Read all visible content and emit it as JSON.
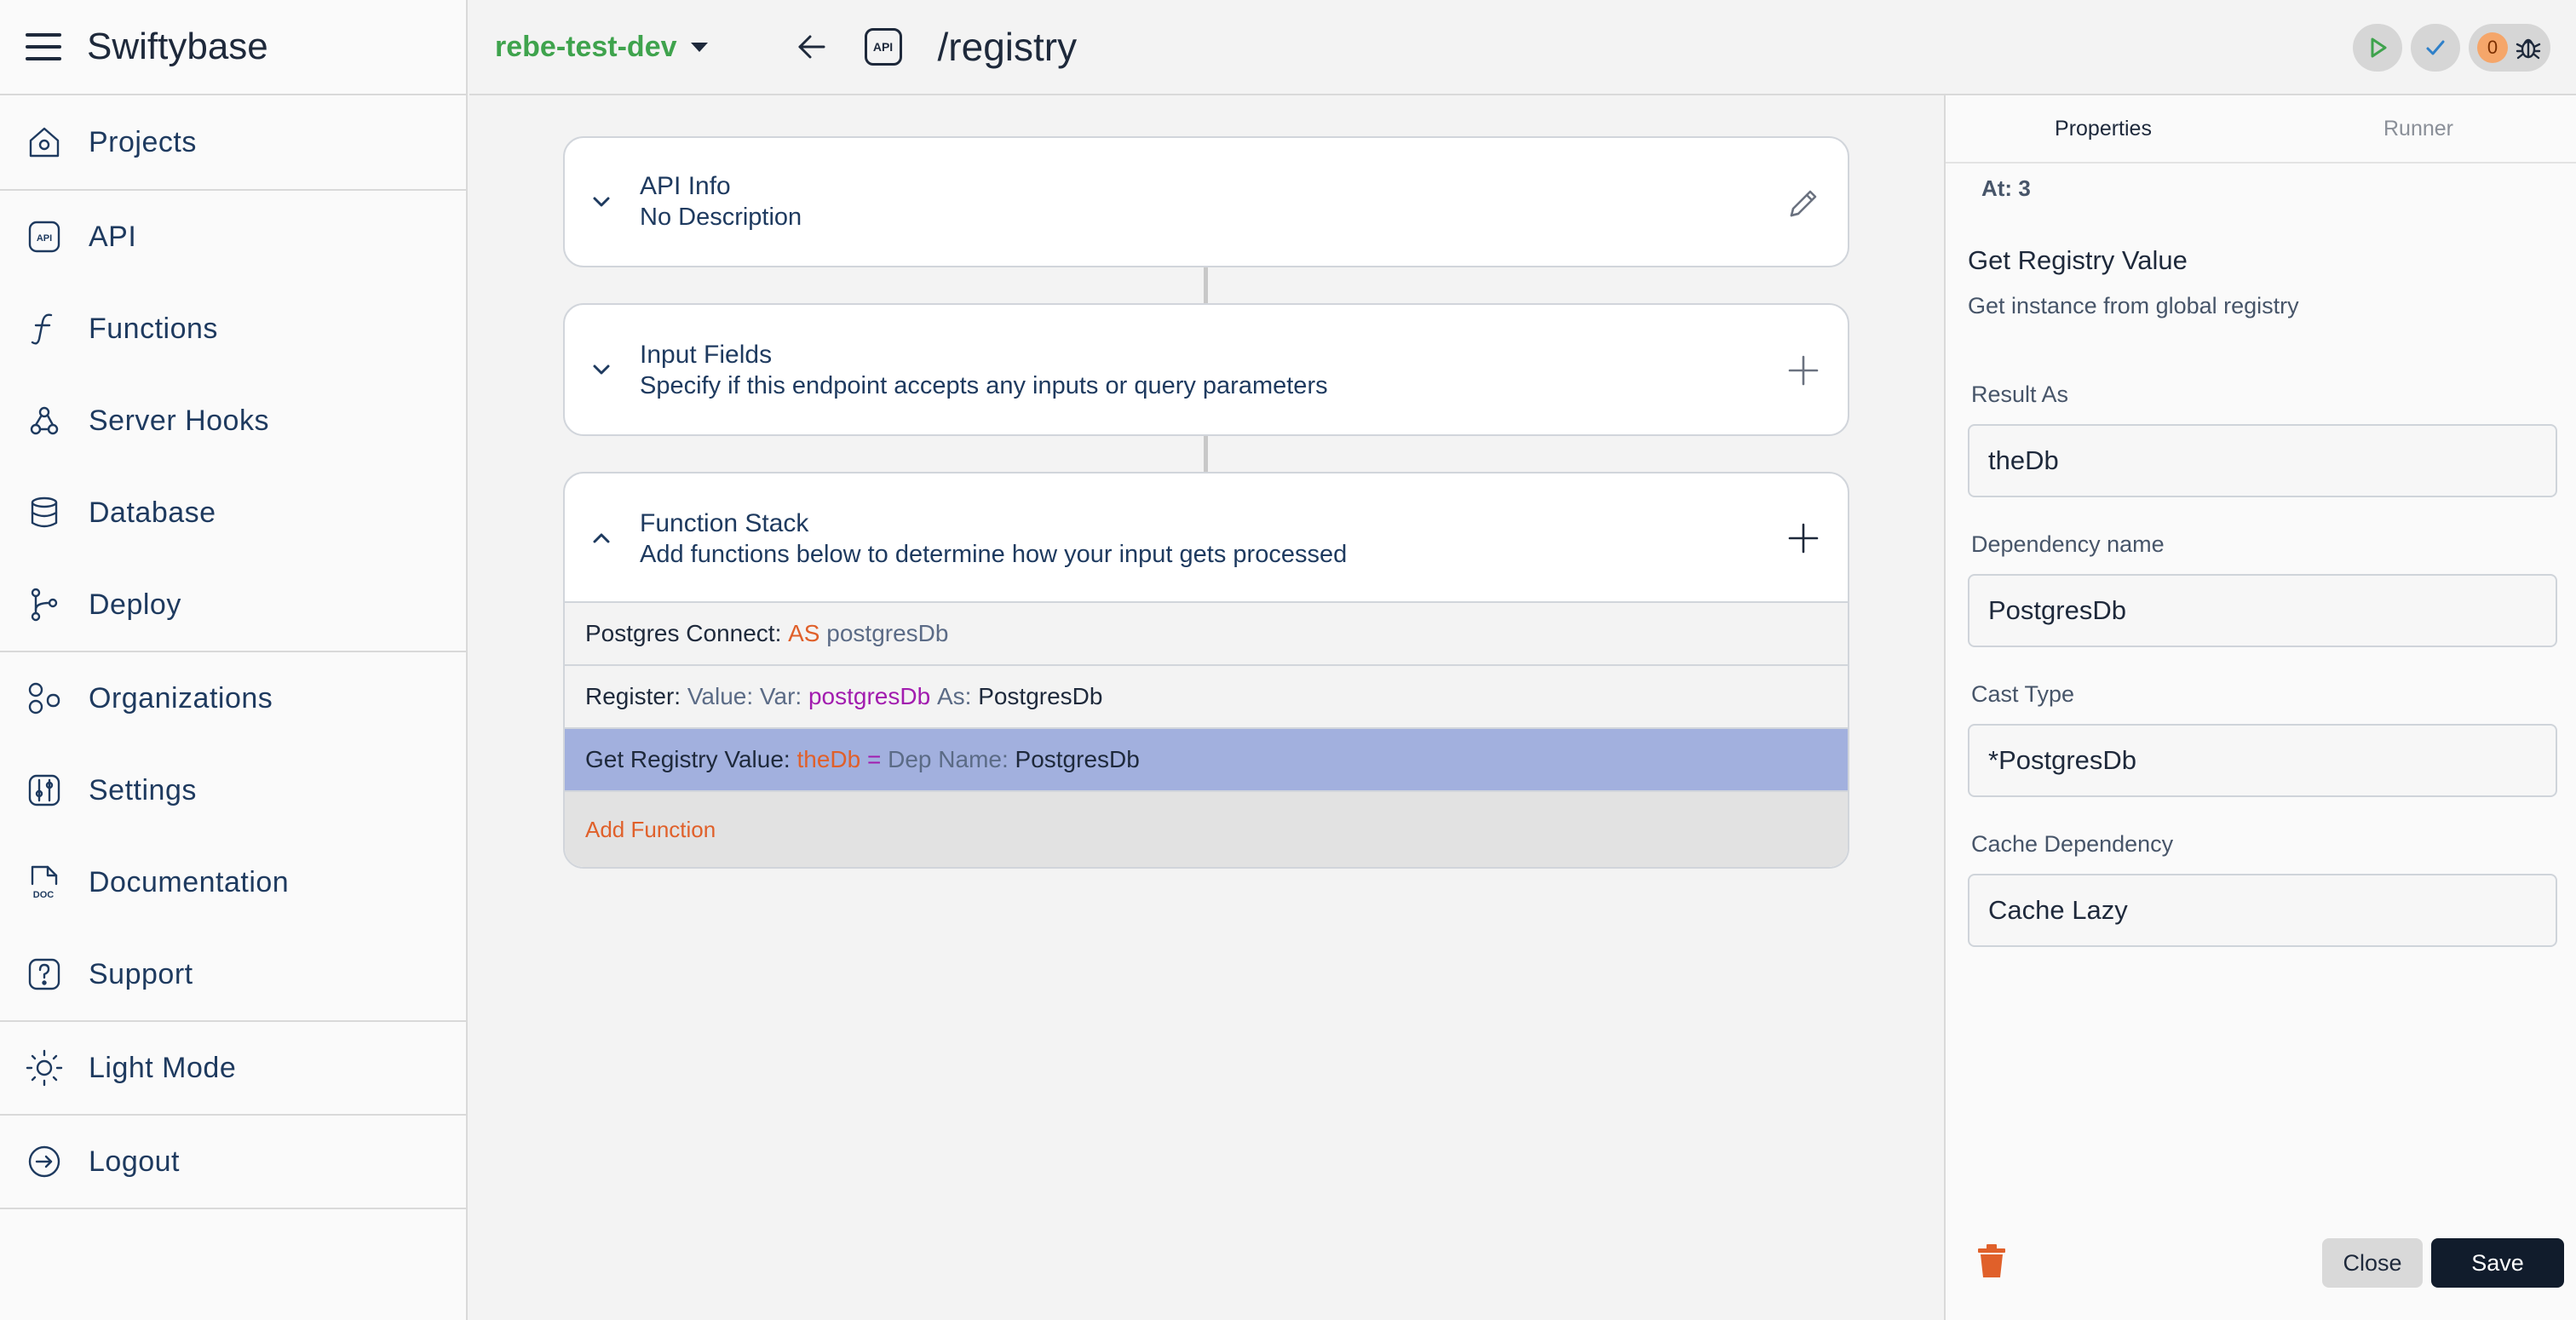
{
  "app": {
    "title": "Swiftybase"
  },
  "sidebar": {
    "groups": [
      [
        {
          "label": "Projects",
          "icon": "home-icon"
        }
      ],
      [
        {
          "label": "API",
          "icon": "api-icon"
        },
        {
          "label": "Functions",
          "icon": "function-icon"
        },
        {
          "label": "Server Hooks",
          "icon": "webhook-icon"
        },
        {
          "label": "Database",
          "icon": "database-icon"
        },
        {
          "label": "Deploy",
          "icon": "git-branch-icon"
        }
      ],
      [
        {
          "label": "Organizations",
          "icon": "organizations-icon"
        },
        {
          "label": "Settings",
          "icon": "settings-icon"
        },
        {
          "label": "Documentation",
          "icon": "doc-icon"
        },
        {
          "label": "Support",
          "icon": "help-icon"
        }
      ],
      [
        {
          "label": "Light Mode",
          "icon": "sun-icon"
        }
      ],
      [
        {
          "label": "Logout",
          "icon": "logout-icon"
        }
      ]
    ]
  },
  "topbar": {
    "environment": "rebe-test-dev",
    "api_badge": "API",
    "route": "/registry",
    "issue_count": "0"
  },
  "main": {
    "api_info": {
      "title": "API Info",
      "subtitle": "No Description"
    },
    "input_fields": {
      "title": "Input Fields",
      "subtitle": "Specify if this endpoint accepts any inputs or query parameters"
    },
    "function_stack": {
      "title": "Function Stack",
      "subtitle": "Add functions below to determine how your input gets processed",
      "rows": [
        {
          "parts": [
            {
              "t": "Postgres Connect: ",
              "c": "dark"
            },
            {
              "t": "AS ",
              "c": "orange"
            },
            {
              "t": "postgresDb",
              "c": "grey"
            }
          ],
          "selected": false
        },
        {
          "parts": [
            {
              "t": "Register: ",
              "c": "dark"
            },
            {
              "t": "Value: Var: ",
              "c": "grey"
            },
            {
              "t": "postgresDb ",
              "c": "purple"
            },
            {
              "t": "As: ",
              "c": "grey"
            },
            {
              "t": "PostgresDb",
              "c": "dark"
            }
          ],
          "selected": false
        },
        {
          "parts": [
            {
              "t": "Get Registry Value: ",
              "c": "dark"
            },
            {
              "t": "theDb ",
              "c": "orange"
            },
            {
              "t": "= ",
              "c": "purple"
            },
            {
              "t": "Dep Name: ",
              "c": "grey"
            },
            {
              "t": "PostgresDb",
              "c": "dark"
            }
          ],
          "selected": true
        }
      ],
      "add_label": "Add Function"
    }
  },
  "panel": {
    "tabs": {
      "properties": "Properties",
      "runner": "Runner"
    },
    "at": "At: 3",
    "title": "Get Registry Value",
    "description": "Get instance from global registry",
    "fields": {
      "result_as": {
        "label": "Result As",
        "value": "theDb"
      },
      "dependency_name": {
        "label": "Dependency name",
        "value": "PostgresDb"
      },
      "cast_type": {
        "label": "Cast Type",
        "value": "*PostgresDb"
      },
      "cache_dependency": {
        "label": "Cache Dependency",
        "value": "Cache Lazy"
      }
    },
    "close_label": "Close",
    "save_label": "Save"
  },
  "colors": {
    "environment": "#3fa34d",
    "selected_row": "#a2b0de",
    "accent_orange": "#e0602a",
    "save_button": "#111c2c"
  }
}
